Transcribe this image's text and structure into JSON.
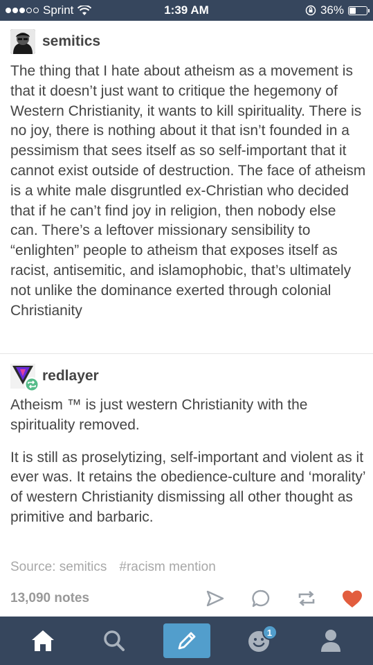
{
  "status_bar": {
    "carrier": "Sprint",
    "time": "1:39 AM",
    "battery": "36%",
    "battery_fraction": 0.36
  },
  "post": {
    "reblogs": [
      {
        "username": "semitics",
        "paragraphs": [
          "The thing that I hate about atheism as a movement is that it doesn’t just want to critique the hegemony of Western Christianity, it wants to kill spirituality. There is no joy, there is nothing about it that isn’t founded in a pessimism that sees itself as so self-important that it cannot exist outside of destruction. The face of atheism is a white male disgruntled ex-Christian who decided that if he can’t find joy in religion, then nobody else can. There’s a leftover missionary sensibility to “enlighten” people to atheism that exposes itself as racist, antisemitic, and islamophobic, that’s ultimately not unlike the dominance exerted through colonial Christianity"
        ]
      },
      {
        "username": "redlayer",
        "paragraphs": [
          "Atheism ™ is just western Christianity with the spirituality removed.",
          "It is still as proselytizing, self-important and violent as it ever was. It retains the obedience-culture and ‘morality’ of western Christianity dismissing all other thought as primitive and barbaric."
        ]
      }
    ],
    "source": "Source: semitics",
    "tag": "#racism mention",
    "notes": "13,090 notes"
  },
  "tab_bar": {
    "notification_count": "1"
  },
  "colors": {
    "navy": "#36465d",
    "blue": "#529ecc",
    "heart": "#e25d3e",
    "text": "#444444"
  }
}
